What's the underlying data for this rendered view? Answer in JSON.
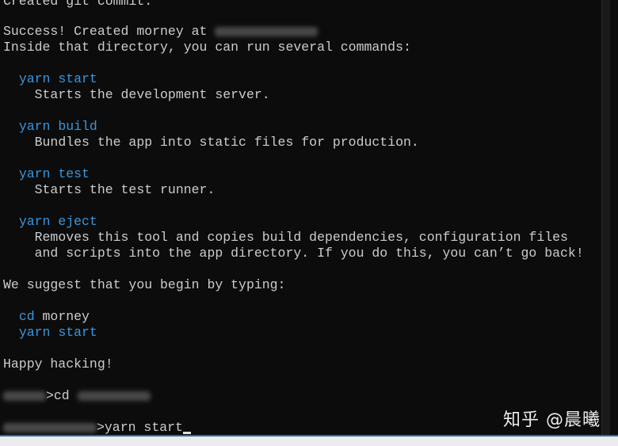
{
  "terminal": {
    "line_git_commit": "Created git commit.",
    "success_prefix": "Success! Created morney at ",
    "inside_dir": "Inside that directory, you can run several commands:",
    "cmd_start": "yarn start",
    "desc_start": "Starts the development server.",
    "cmd_build": "yarn build",
    "desc_build": "Bundles the app into static files for production.",
    "cmd_test": "yarn test",
    "desc_test": "Starts the test runner.",
    "cmd_eject": "yarn eject",
    "desc_eject_1": "Removes this tool and copies build dependencies, configuration files",
    "desc_eject_2": "and scripts into the app directory. If you do this, you can’t go back!",
    "suggest": "We suggest that you begin by typing:",
    "suggest_cd_cmd": "cd",
    "suggest_cd_arg": " morney",
    "suggest_start": "yarn start",
    "happy": "Happy hacking!",
    "prompt1_cmd": "cd ",
    "prompt2_cmd": "yarn start"
  },
  "watermark": "知乎 @晨曦",
  "colors": {
    "background": "#0c0c0c",
    "text": "#cccccc",
    "command": "#3a96dd"
  }
}
